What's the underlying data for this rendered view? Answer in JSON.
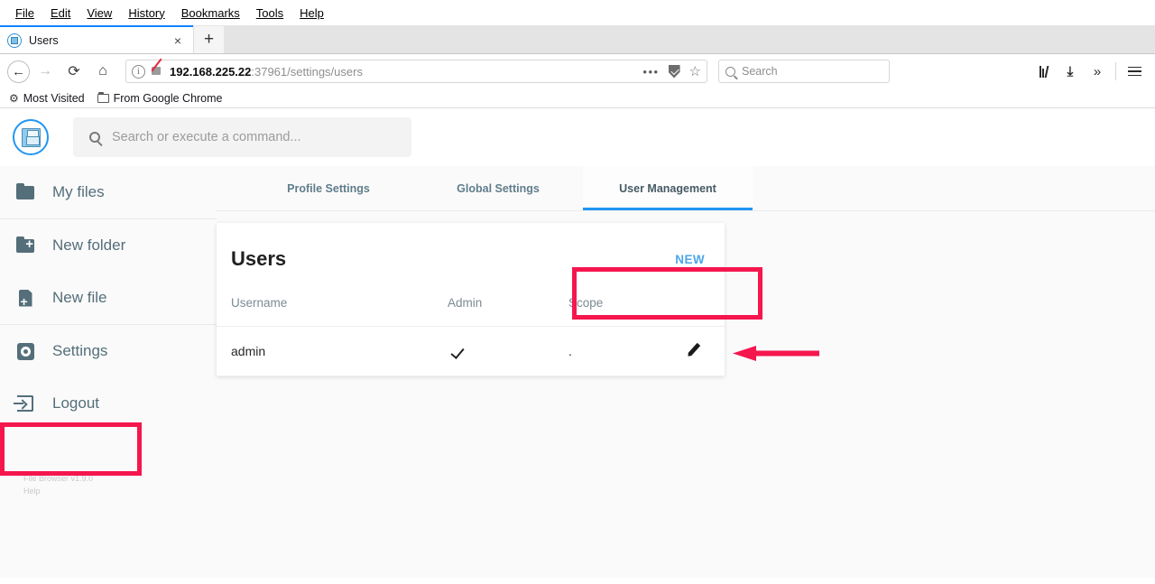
{
  "browser": {
    "menus": [
      "File",
      "Edit",
      "View",
      "History",
      "Bookmarks",
      "Tools",
      "Help"
    ],
    "tab": {
      "title": "Users",
      "favicon": "floppy-disk-icon",
      "close": "×"
    },
    "newtab_label": "+",
    "nav": {
      "back": "←",
      "forward": "→",
      "reload": "⟳",
      "home": "⌂"
    },
    "url": {
      "host": "192.168.225.22",
      "rest": ":37961/settings/users",
      "info_glyph": "i",
      "dots": "•••"
    },
    "search": {
      "placeholder": "Search"
    },
    "bookmarks": [
      {
        "label": "Most Visited",
        "icon": "gear-icon"
      },
      {
        "label": "From Google Chrome",
        "icon": "folder-icon"
      }
    ],
    "toolbar_right": [
      "library-icon",
      "downloads-icon",
      "overflow-chevrons-icon",
      "hamburger-menu-icon"
    ],
    "overflow_glyph": "»"
  },
  "app": {
    "logo": "floppy-disk-logo",
    "command_bar": {
      "placeholder": "Search or execute a command..."
    },
    "sidebar": {
      "items": [
        {
          "label": "My files",
          "icon": "folder-icon"
        },
        {
          "label": "New folder",
          "icon": "folder-plus-icon"
        },
        {
          "label": "New file",
          "icon": "file-plus-icon"
        },
        {
          "label": "Settings",
          "icon": "gear-icon"
        },
        {
          "label": "Logout",
          "icon": "logout-icon"
        }
      ],
      "footer": {
        "version": "File Browser v1.9.0",
        "help": "Help"
      }
    },
    "tabs": [
      {
        "label": "Profile Settings",
        "active": false
      },
      {
        "label": "Global Settings",
        "active": false
      },
      {
        "label": "User Management",
        "active": true
      }
    ],
    "users_card": {
      "title": "Users",
      "new_label": "NEW",
      "columns": [
        "Username",
        "Admin",
        "Scope",
        ""
      ],
      "rows": [
        {
          "username": "admin",
          "admin": true,
          "admin_glyph": "✓",
          "scope": ".",
          "action": "edit-pencil-icon"
        }
      ]
    }
  },
  "annotations": {
    "color": "#f5164e",
    "boxes": [
      {
        "name": "settings-highlight",
        "target": "Settings"
      },
      {
        "name": "user-management-tab-highlight",
        "target": "User Management"
      }
    ],
    "arrow": {
      "name": "new-button-arrow",
      "points_to": "NEW",
      "direction": "left"
    }
  },
  "theme": {
    "accent_blue": "#2196f3",
    "link_blue": "#4da6e8",
    "sidebar_text": "#546e7a",
    "annotation_red": "#f5164e",
    "page_bg": "#fafafa"
  }
}
